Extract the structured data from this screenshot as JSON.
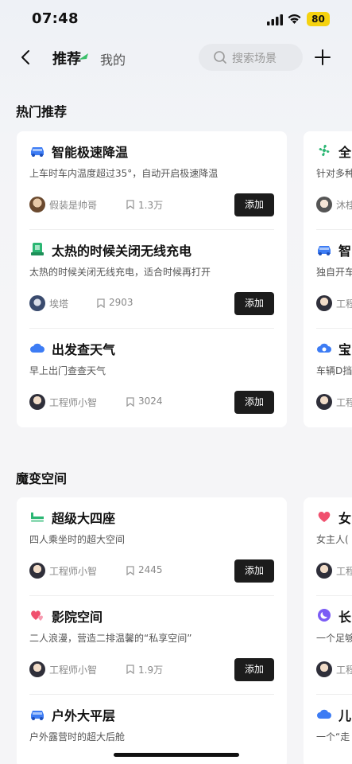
{
  "status_bar": {
    "time": "07:48",
    "battery": "80",
    "battery_color": "#f5d20f"
  },
  "nav": {
    "back_icon": "chevron-left-icon",
    "tab_active": "推荐",
    "tab_inactive": "我的",
    "search_placeholder": "搜索场景",
    "add_icon": "plus-icon"
  },
  "sections": [
    {
      "title": "热门推荐",
      "items": [
        {
          "icon": "car-snow-icon",
          "title": "智能极速降温",
          "desc": "上车时车内温度超过35°，自动开启极速降温",
          "author": "假装是帅哥",
          "count": "1.3万",
          "button": "添加"
        },
        {
          "icon": "phone-charge-icon",
          "title": "太热的时候关闭无线充电",
          "desc": "太热的时候关闭无线充电，适合时候再打开",
          "author": "埃塔",
          "count": "2903",
          "button": "添加"
        },
        {
          "icon": "cloud-icon",
          "title": "出发查天气",
          "desc": "早上出门查查天气",
          "author": "工程师小智",
          "count": "3024",
          "button": "添加"
        }
      ],
      "peek": [
        {
          "icon": "fan-icon",
          "title": "全",
          "desc": "针对多种",
          "author": "沐桂"
        },
        {
          "icon": "car-icon",
          "title": "智",
          "desc": "独自开车",
          "author": "工程"
        },
        {
          "icon": "cloud-moon-icon",
          "title": "宝",
          "desc": "车辆D挡",
          "author": "工程"
        }
      ]
    },
    {
      "title": "魔变空间",
      "items": [
        {
          "icon": "seat-icon",
          "title": "超级大四座",
          "desc": "四人乘坐时的超大空间",
          "author": "工程师小智",
          "count": "2445",
          "button": "添加"
        },
        {
          "icon": "hearts-icon",
          "title": "影院空间",
          "desc": "二人浪漫，营造二排温馨的“私享空间”",
          "author": "工程师小智",
          "count": "1.9万",
          "button": "添加"
        },
        {
          "icon": "car-flat-icon",
          "title": "户外大平层",
          "desc": "户外露营时的超大后舱",
          "author": "",
          "count": "",
          "button": ""
        }
      ],
      "peek": [
        {
          "icon": "heart-icon",
          "title": "女",
          "desc": "女主人(",
          "author": "工程"
        },
        {
          "icon": "moon-icon",
          "title": "长",
          "desc": "一个足够",
          "author": "工程"
        },
        {
          "icon": "cloud-icon",
          "title": "儿",
          "desc": "一个“走",
          "author": ""
        }
      ]
    }
  ],
  "colors": {
    "accent_blue": "#3d7cf4",
    "accent_green": "#2bb673",
    "accent_pink": "#f0506e",
    "accent_purple": "#7b5cf5",
    "button_bg": "#1c1c1c"
  }
}
